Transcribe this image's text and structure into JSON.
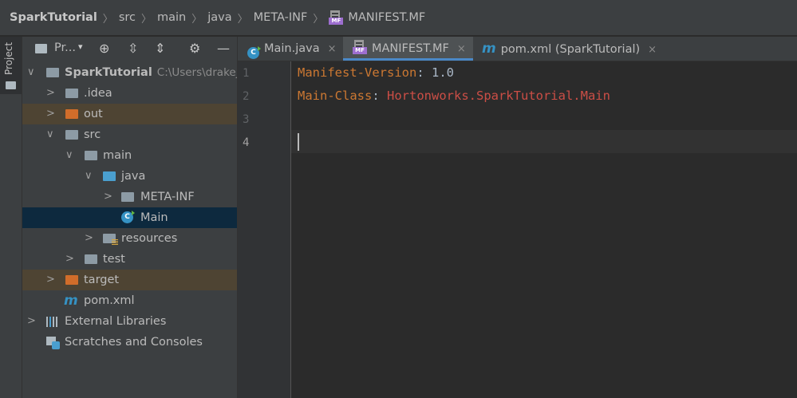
{
  "breadcrumb": {
    "items": [
      "SparkTutorial",
      "src",
      "main",
      "java",
      "META-INF",
      "MANIFEST.MF"
    ],
    "mf_icon_text": "MF"
  },
  "sidebar_strip": {
    "label": "Project"
  },
  "project_panel": {
    "title": "Pr...",
    "dropdown_glyph": "▾",
    "toolbar_icons": [
      "crosshair-icon",
      "expand-all-icon",
      "collapse-all-icon",
      "gear-icon",
      "minimize-icon"
    ],
    "tree": {
      "root": {
        "name": "SparkTutorial",
        "path": "C:\\Users\\drakej\\"
      },
      "idea": ".idea",
      "out": "out",
      "src": "src",
      "main": "main",
      "java": "java",
      "meta_inf": "META-INF",
      "main_class": "Main",
      "resources": "resources",
      "test": "test",
      "target": "target",
      "pom": "pom.xml",
      "external_libraries": "External Libraries",
      "scratches": "Scratches and Consoles"
    }
  },
  "tabs": [
    {
      "label": "Main.java",
      "close": "×"
    },
    {
      "label": "MANIFEST.MF",
      "close": "×",
      "active": true
    },
    {
      "label": "pom.xml (SparkTutorial)",
      "close": "×"
    }
  ],
  "editor": {
    "line_numbers": [
      "1",
      "2",
      "3",
      "4"
    ],
    "lines": [
      {
        "key": "Manifest-Version",
        "colon": ": ",
        "value": "1.0"
      },
      {
        "key": "Main-Class",
        "colon": ": ",
        "value": "Hortonworks.SparkTutorial.Main"
      }
    ]
  },
  "colors": {
    "key": "#cc7832",
    "value_number": "#a9b7c6",
    "value_class": "#cc4e46",
    "selection": "#0d293e",
    "excluded": "#4e4433",
    "tab_underline": "#4a88c7"
  }
}
